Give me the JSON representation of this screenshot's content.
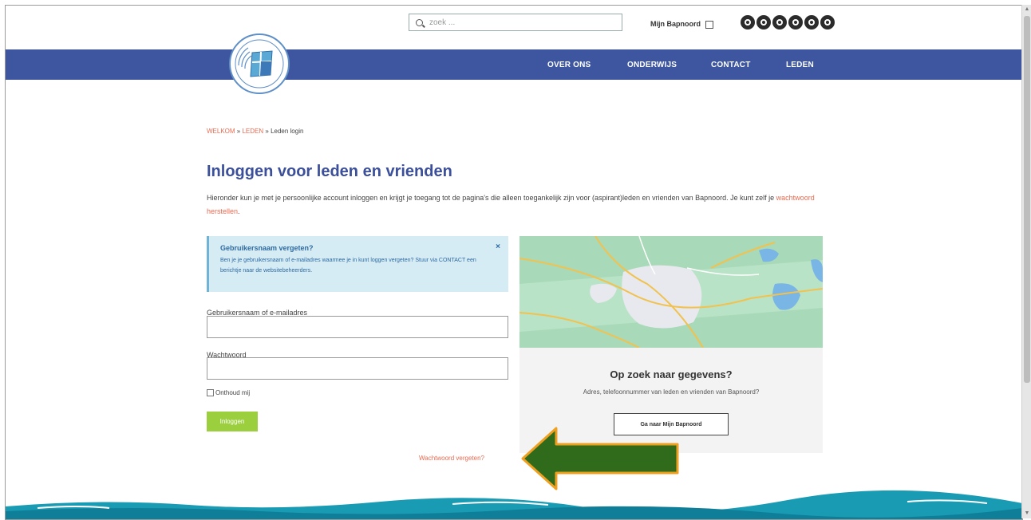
{
  "header": {
    "search_placeholder": "zoek ...",
    "mijn_link": "Mijn Bapnoord",
    "social_icons": [
      "facebook-icon",
      "instagram-icon",
      "pinterest-icon",
      "twitter-icon",
      "linkedin-icon",
      "youtube-icon"
    ]
  },
  "nav": {
    "items": [
      "OVER ONS",
      "ONDERWIJS",
      "CONTACT",
      "LEDEN"
    ]
  },
  "breadcrumb": {
    "home": "WELKOM",
    "sep": " » ",
    "leden": "LEDEN",
    "current": "Leden login"
  },
  "main": {
    "title": "Inloggen voor leden en vrienden",
    "intro_text": "Hieronder kun je met je persoonlijke account inloggen en krijgt je toegang tot de pagina's die alleen toegankelijk zijn voor (aspirant)leden en vrienden van Bapnoord. Je kunt zelf je ",
    "intro_link": "wachtwoord herstellen",
    "intro_end": "."
  },
  "notice": {
    "title": "Gebruikersnaam vergeten?",
    "body": "Ben je je gebruikersnaam of e-mailadres waarmee je in kunt loggen vergeten? Stuur via CONTACT een berichtje naar de websitebeheerders.",
    "close": "×"
  },
  "form": {
    "username_label": "Gebruikersnaam of e-mailadres",
    "password_label": "Wachtwoord",
    "remember_label": "Onthoud mij",
    "login_button": "Inloggen",
    "forgot_link": "Wachtwoord vergeten?"
  },
  "card": {
    "title": "Op zoek naar gegevens?",
    "text": "Adres, telefoonnummer van leden en vrienden van Bapnoord?",
    "button": "Ga naar Mijn Bapnoord"
  },
  "colors": {
    "nav_blue": "#3e56a0",
    "link_orange": "#e86a50",
    "button_green": "#9bcf3e",
    "arrow_green": "#2f6b1a",
    "arrow_outline": "#f0a020"
  }
}
